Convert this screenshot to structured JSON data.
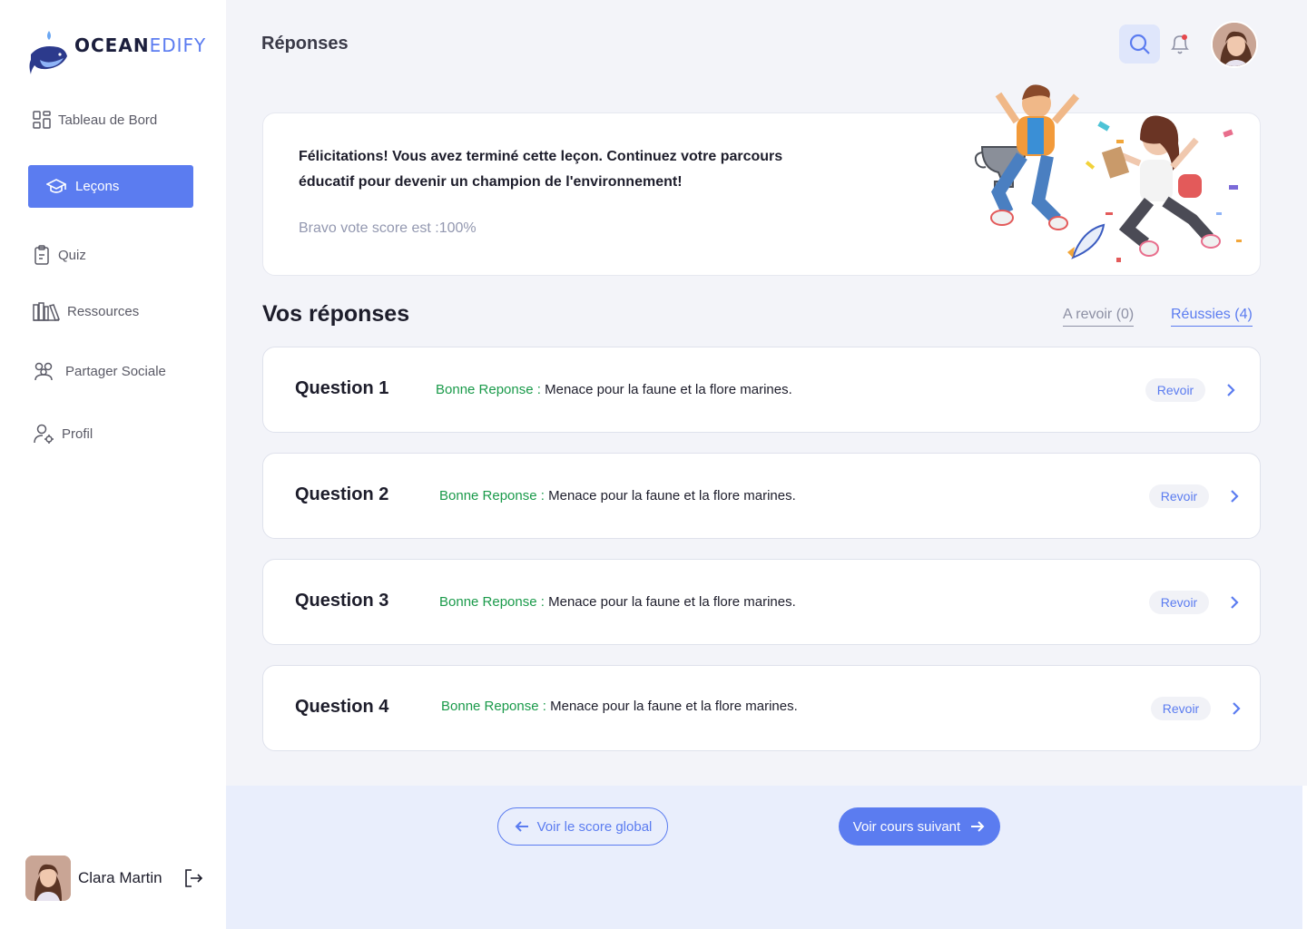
{
  "brand": {
    "name_part1": "OCEAN",
    "name_part2": "EDIFY"
  },
  "sidebar": {
    "items": [
      {
        "label": "Tableau de Bord",
        "icon": "dashboard-icon"
      },
      {
        "label": "Leçons",
        "icon": "graduation-cap-icon",
        "active": true
      },
      {
        "label": "Quiz",
        "icon": "clipboard-icon"
      },
      {
        "label": "Ressources",
        "icon": "books-icon"
      },
      {
        "label": "Partager Sociale",
        "icon": "users-icon"
      },
      {
        "label": "Profil",
        "icon": "user-gear-icon"
      }
    ],
    "user": {
      "name": "Clara Martin"
    }
  },
  "header": {
    "title": "Réponses"
  },
  "banner": {
    "message": "Félicitations! Vous avez terminé cette leçon. Continuez votre parcours éducatif pour devenir un champion de l'environnement!",
    "score": "Bravo vote score est :100%"
  },
  "answers": {
    "title": "Vos réponses",
    "tabs": {
      "review": "A revoir (0)",
      "success": "Réussies (4)"
    },
    "correct_label": "Bonne Reponse",
    "separator": " : ",
    "review_label": "Revoir",
    "questions": [
      {
        "title": "Question 1",
        "answer": "Menace pour la faune et la flore marines."
      },
      {
        "title": "Question 2",
        "answer": "Menace pour la faune et la flore marines."
      },
      {
        "title": "Question 3",
        "answer": "Menace pour la faune et la flore marines."
      },
      {
        "title": "Question 4",
        "answer": "Menace pour la faune et la flore marines."
      }
    ]
  },
  "footer": {
    "back_label": "Voir le score global",
    "next_label": "Voir cours suivant"
  },
  "colors": {
    "accent": "#5b7cf0",
    "success": "#1a9a4a",
    "background": "#f3f4f9"
  }
}
